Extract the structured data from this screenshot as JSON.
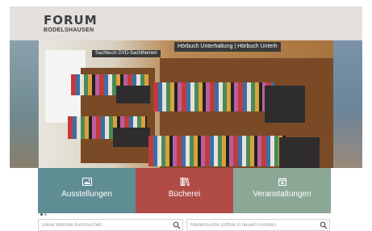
{
  "header": {
    "logo_main": "FORUM",
    "logo_sub": "BODELSHAUSEN"
  },
  "hero": {
    "sign_left": "Sachbuch",
    "sign_left2": "DVD-Sachthemen",
    "sign_right": "Hörbuch Unterhaltung | Hörbuch Unterh"
  },
  "tiles": [
    {
      "label": "Ausstellungen",
      "icon": "image-icon",
      "color": "#5f8d94"
    },
    {
      "label": "Bücherei",
      "icon": "books-icon",
      "color": "#b04b46"
    },
    {
      "label": "Veranstaltungen",
      "icon": "calendar-icon",
      "color": "#8ba795"
    }
  ],
  "search": {
    "website_placeholder": "Diese Website durchsuchen",
    "media_placeholder": "Mediensuche (Öffnet in neuem Fenster)"
  }
}
